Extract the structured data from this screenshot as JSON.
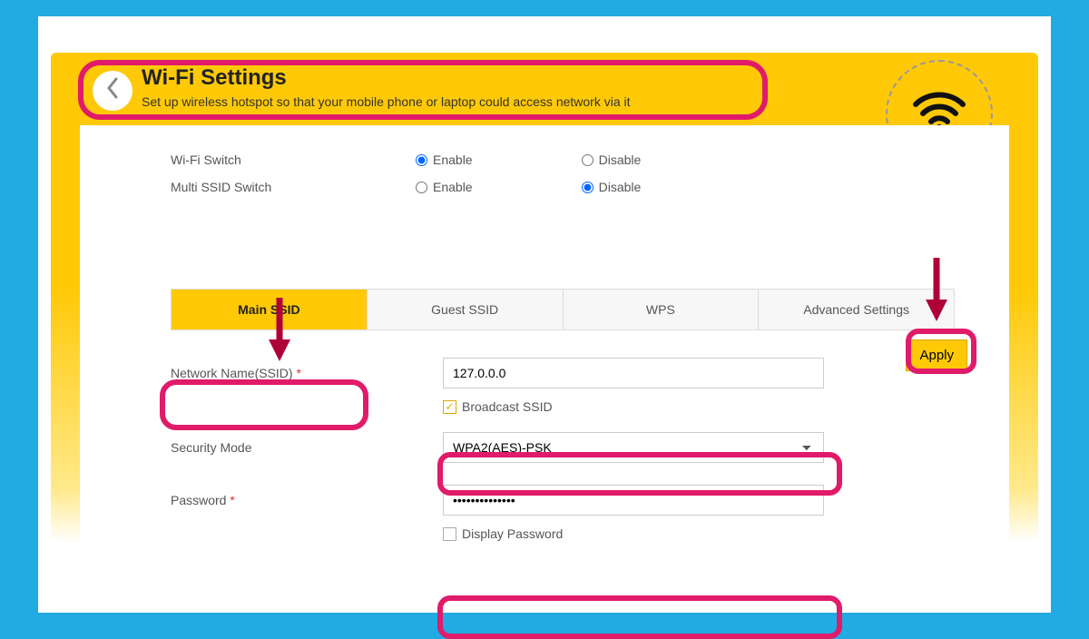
{
  "header": {
    "title": "Wi-Fi Settings",
    "subtitle": "Set up wireless hotspot so that your mobile phone or laptop could access network via it"
  },
  "switches": {
    "wifi_label": "Wi-Fi Switch",
    "multi_label": "Multi SSID Switch",
    "enable": "Enable",
    "disable": "Disable"
  },
  "apply_label": "Apply",
  "tabs": {
    "main": "Main SSID",
    "guest": "Guest SSID",
    "wps": "WPS",
    "advanced": "Advanced Settings"
  },
  "form": {
    "ssid_label": "Network Name(SSID)",
    "ssid_value": "127.0.0.0",
    "broadcast_label": "Broadcast SSID",
    "security_label": "Security Mode",
    "security_value": "WPA2(AES)-PSK",
    "password_label": "Password",
    "password_value": "••••••••••••••",
    "display_pw_label": "Display Password"
  }
}
